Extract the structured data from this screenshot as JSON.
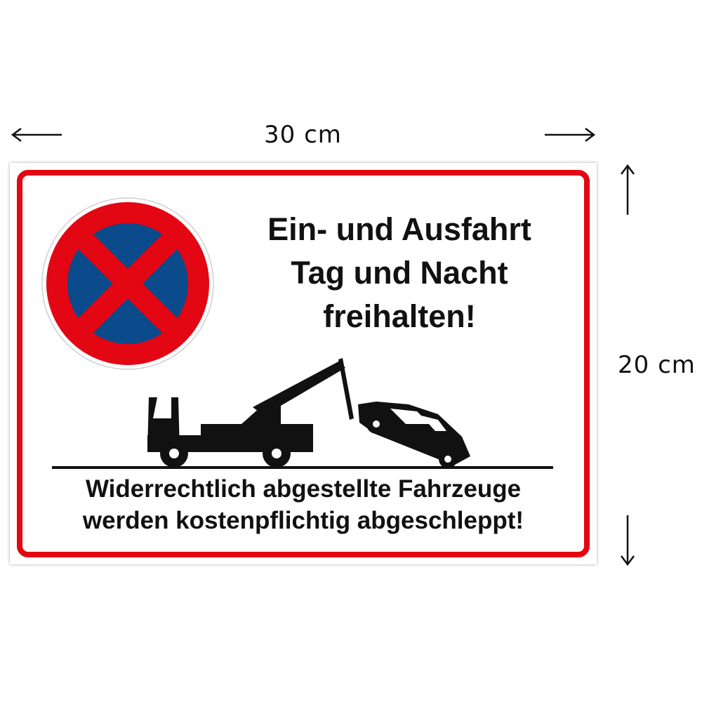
{
  "dimensions": {
    "width_label": "30 cm",
    "height_label": "20 cm"
  },
  "sign": {
    "headline_lines": [
      "Ein- und Ausfahrt",
      "Tag und Nacht",
      "freihalten!"
    ],
    "footer_lines": [
      "Widerrechtlich abgestellte Fahrzeuge",
      "werden kostenpflichtig abgeschleppt!"
    ]
  },
  "colors": {
    "frame_red": "#e30613",
    "sign_blue": "#0b4a8b",
    "text": "#111111"
  },
  "icons": [
    "arrow-left-icon",
    "arrow-right-icon",
    "arrow-up-icon",
    "arrow-down-icon",
    "no-stopping-sign-icon",
    "tow-truck-icon",
    "towed-car-icon"
  ]
}
